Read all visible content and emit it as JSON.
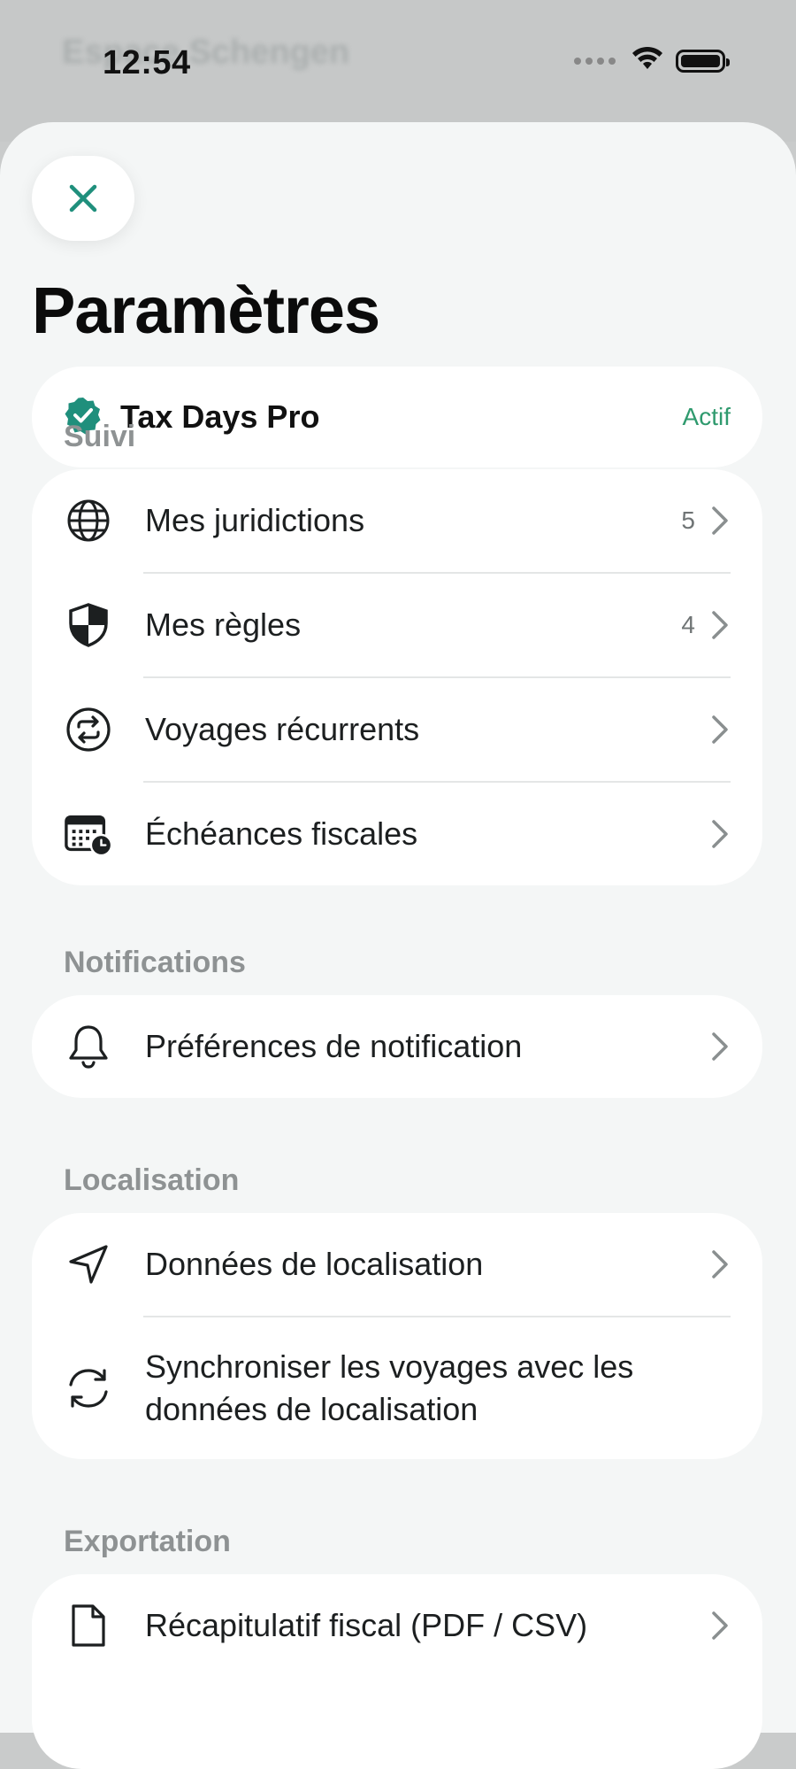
{
  "status_bar": {
    "time": "12:54"
  },
  "backdrop": {
    "title_blurred": "Espace Schengen"
  },
  "header": {
    "title": "Paramètres"
  },
  "subscription": {
    "label": "Tax Days Pro",
    "status": "Actif"
  },
  "sections": {
    "tracking": {
      "label": "Suivi",
      "items": [
        {
          "label": "Mes juridictions",
          "count": "5",
          "icon": "globe-icon"
        },
        {
          "label": "Mes règles",
          "count": "4",
          "icon": "shield-icon"
        },
        {
          "label": "Voyages récurrents",
          "count": "",
          "icon": "recurring-icon"
        },
        {
          "label": "Échéances fiscales",
          "count": "",
          "icon": "calendar-clock-icon"
        }
      ]
    },
    "notifications": {
      "label": "Notifications",
      "items": [
        {
          "label": "Préférences de notification",
          "icon": "bell-icon"
        }
      ]
    },
    "location": {
      "label": "Localisation",
      "items": [
        {
          "label": "Données de localisation",
          "icon": "location-arrow-icon"
        },
        {
          "label": "Synchroniser les voyages avec les données de localisation",
          "icon": "sync-icon"
        }
      ]
    },
    "export": {
      "label": "Exportation",
      "items": [
        {
          "label": "Récapitulatif fiscal (PDF / CSV)",
          "icon": "document-icon"
        }
      ]
    }
  },
  "colors": {
    "accent": "#1f8f7c",
    "active_status": "#2f9a6e"
  }
}
